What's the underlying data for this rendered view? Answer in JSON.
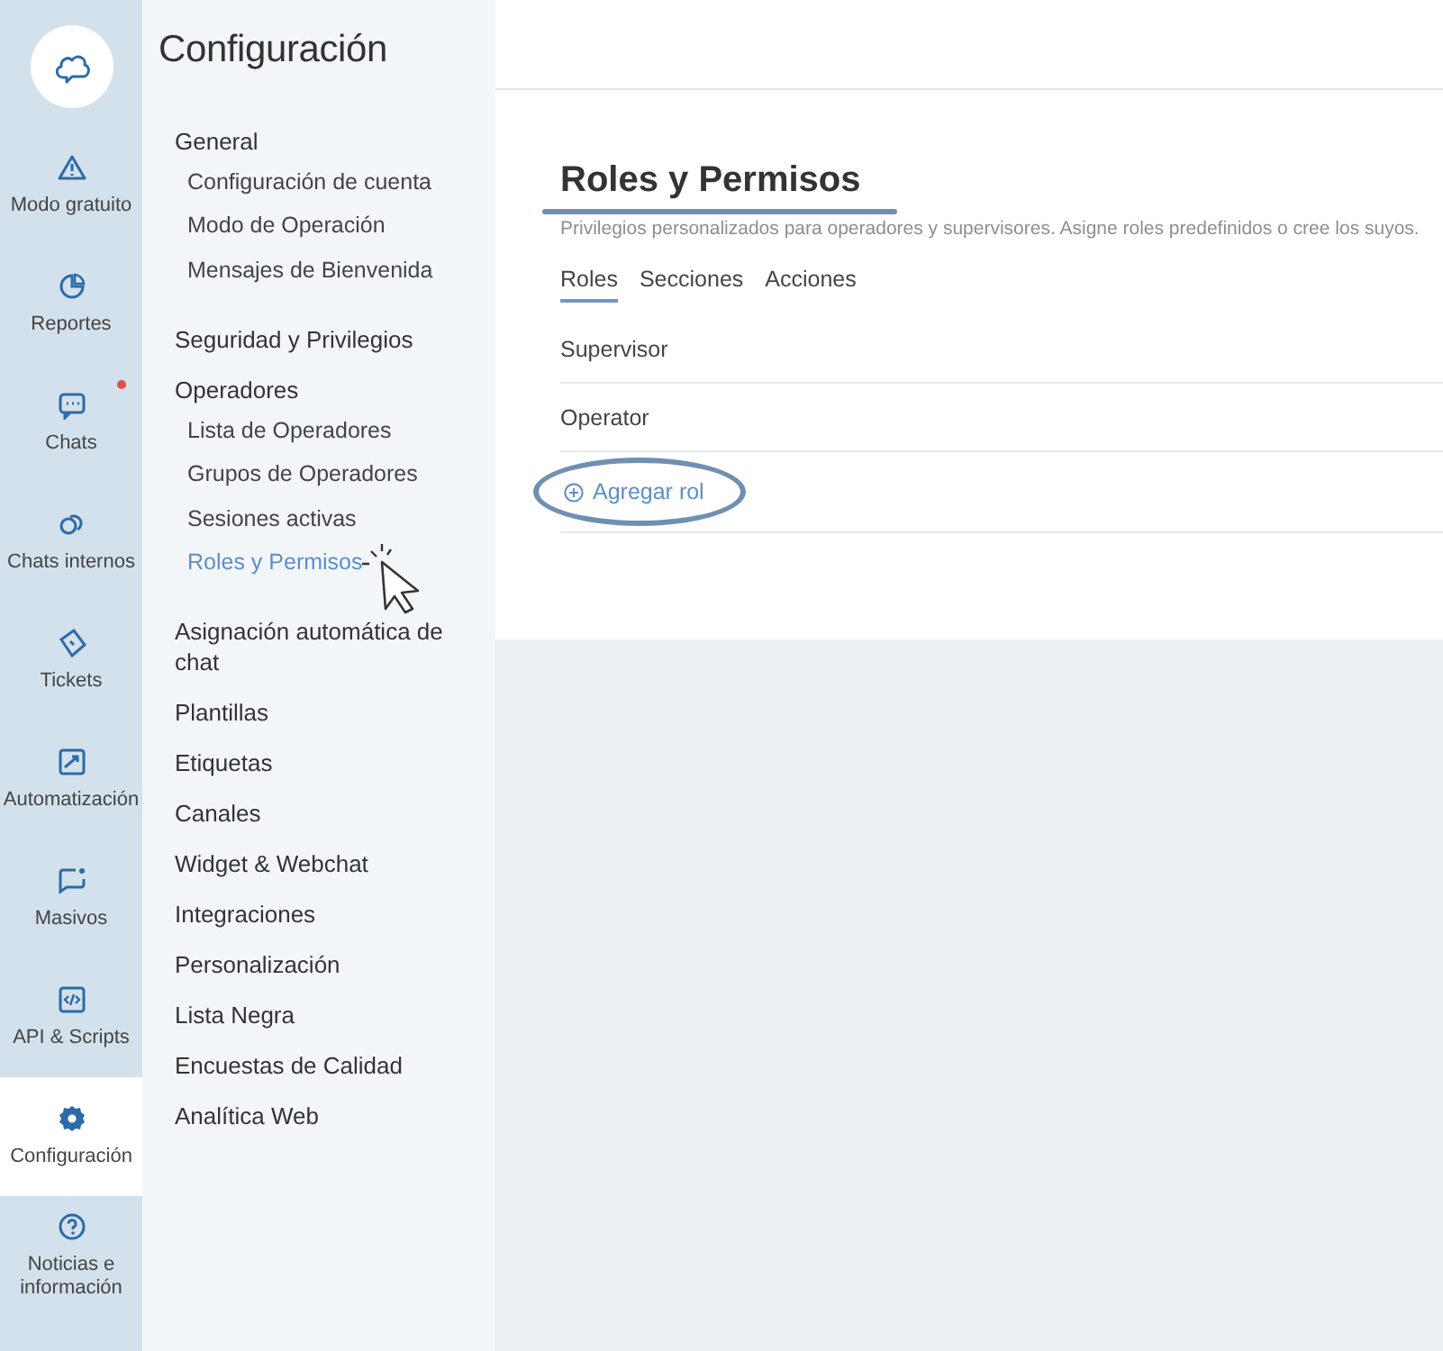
{
  "rail": {
    "items": [
      {
        "label": "Modo gratuito",
        "selected": false,
        "badge": false
      },
      {
        "label": "Reportes",
        "selected": false,
        "badge": false
      },
      {
        "label": "Chats",
        "selected": false,
        "badge": true
      },
      {
        "label": "Chats internos",
        "selected": false,
        "badge": false
      },
      {
        "label": "Tickets",
        "selected": false,
        "badge": false
      },
      {
        "label": "Automatización",
        "selected": false,
        "badge": false
      },
      {
        "label": "Masivos",
        "selected": false,
        "badge": false
      },
      {
        "label": "API & Scripts",
        "selected": false,
        "badge": false
      },
      {
        "label": "Configuración",
        "selected": true,
        "badge": false
      },
      {
        "label": "Noticias e información",
        "selected": false,
        "badge": false
      }
    ]
  },
  "settings_menu": {
    "title": "Configuración",
    "sections": [
      {
        "label": "General",
        "children": [
          {
            "label": "Configuración de cuenta",
            "selected": false
          },
          {
            "label": "Modo de Operación",
            "selected": false
          },
          {
            "label": "Mensajes de Bienvenida",
            "selected": false
          }
        ]
      },
      {
        "label": "Seguridad y Privilegios"
      },
      {
        "label": "Operadores",
        "children": [
          {
            "label": "Lista de Operadores",
            "selected": false
          },
          {
            "label": "Grupos de Operadores",
            "selected": false
          },
          {
            "label": "Sesiones activas",
            "selected": false
          },
          {
            "label": "Roles y Permisos",
            "selected": true
          }
        ]
      },
      {
        "label": "Asignación automática de chat"
      },
      {
        "label": "Plantillas"
      },
      {
        "label": "Etiquetas"
      },
      {
        "label": "Canales"
      },
      {
        "label": "Widget & Webchat"
      },
      {
        "label": "Integraciones"
      },
      {
        "label": "Personalización"
      },
      {
        "label": "Lista Negra"
      },
      {
        "label": "Encuestas de Calidad"
      },
      {
        "label": "Analítica Web"
      }
    ]
  },
  "page": {
    "title": "Roles y Permisos",
    "subtitle": "Privilegios personalizados para operadores y supervisores. Asigne roles predefinidos o cree los suyos.",
    "tabs": [
      {
        "label": "Roles",
        "selected": true
      },
      {
        "label": "Secciones",
        "selected": false
      },
      {
        "label": "Acciones",
        "selected": false
      }
    ],
    "roles": [
      "Supervisor",
      "Operator"
    ],
    "add_button": "Agregar rol"
  }
}
